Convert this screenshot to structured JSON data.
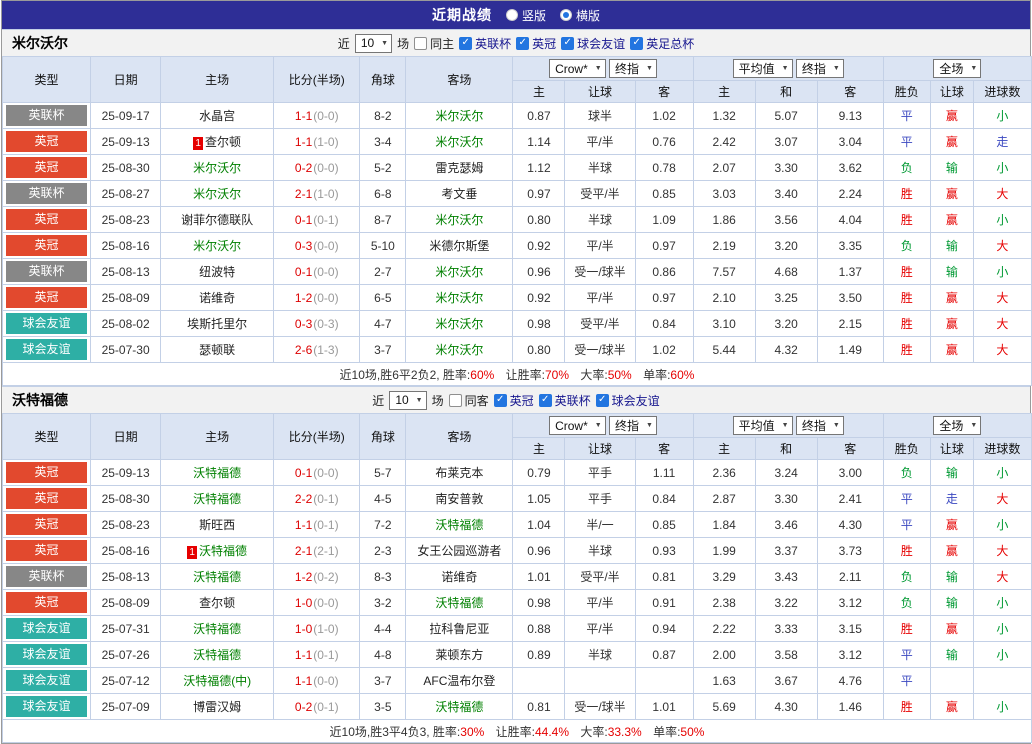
{
  "topbar": {
    "title": "近期战绩",
    "vertical": {
      "label": "竖版",
      "checked": "false"
    },
    "horizontal": {
      "label": "横版",
      "checked": "true"
    }
  },
  "filter_labels": {
    "near": "近",
    "matches": "场"
  },
  "selects": {
    "asia_source": "Crow*",
    "asia_stage": "终指",
    "euro_source": "平均值",
    "euro_stage": "终指",
    "scope": "全场"
  },
  "columns": {
    "type": "类型",
    "date": "日期",
    "home": "主场",
    "score": "比分(半场)",
    "corner": "角球",
    "away": "客场",
    "asia_home": "主",
    "asia_handicap": "让球",
    "asia_away": "客",
    "euro_home": "主",
    "euro_draw": "和",
    "euro_away": "客",
    "res_wdl": "胜负",
    "res_handicap": "让球",
    "res_goals": "进球数"
  },
  "colors": {
    "accent_blue": "#2275e0",
    "topbar": "#2e2e96",
    "league_cup_gray": "#878787",
    "championship_red": "#e2492e",
    "friendly_teal": "#2eafa5",
    "win_red": "#e60000",
    "lose_green": "#009933",
    "draw_blue": "#3b48c0",
    "focus_team_green": "#008000"
  },
  "sections": [
    {
      "team": "米尔沃尔",
      "filter": {
        "count": "10",
        "same_label": "同主",
        "same_checked": "false",
        "leagues": [
          {
            "label": "英联杯",
            "checked": "true"
          },
          {
            "label": "英冠",
            "checked": "true"
          },
          {
            "label": "球会友谊",
            "checked": "true"
          },
          {
            "label": "英足总杯",
            "checked": "true"
          }
        ]
      },
      "rows": [
        {
          "type": "英联杯",
          "tc": "gray",
          "date": "25-09-17",
          "home": "水晶宫",
          "hf": "0",
          "hrc": "",
          "ft": "1-1",
          "ht": "(0-0)",
          "corner": "8-2",
          "away": "米尔沃尔",
          "af": "1",
          "arc": "",
          "a1": "0.87",
          "a2": "球半",
          "a3": "1.02",
          "e1": "1.32",
          "e2": "5.07",
          "e3": "9.13",
          "r1": "平",
          "r1c": "d",
          "r2": "赢",
          "r2c": "w",
          "r3": "小",
          "r3c": "l"
        },
        {
          "type": "英冠",
          "tc": "red",
          "date": "25-09-13",
          "home": "查尔顿",
          "hf": "0",
          "hrc": "1",
          "ft": "1-1",
          "ht": "(1-0)",
          "corner": "3-4",
          "away": "米尔沃尔",
          "af": "1",
          "arc": "",
          "a1": "1.14",
          "a2": "平/半",
          "a3": "0.76",
          "e1": "2.42",
          "e2": "3.07",
          "e3": "3.04",
          "r1": "平",
          "r1c": "d",
          "r2": "赢",
          "r2c": "w",
          "r3": "走",
          "r3c": "d"
        },
        {
          "type": "英冠",
          "tc": "red",
          "date": "25-08-30",
          "home": "米尔沃尔",
          "hf": "1",
          "hrc": "",
          "ft": "0-2",
          "ht": "(0-0)",
          "corner": "5-2",
          "away": "雷克瑟姆",
          "af": "0",
          "arc": "",
          "a1": "1.12",
          "a2": "半球",
          "a3": "0.78",
          "e1": "2.07",
          "e2": "3.30",
          "e3": "3.62",
          "r1": "负",
          "r1c": "l",
          "r2": "输",
          "r2c": "l",
          "r3": "小",
          "r3c": "l"
        },
        {
          "type": "英联杯",
          "tc": "gray",
          "date": "25-08-27",
          "home": "米尔沃尔",
          "hf": "1",
          "hrc": "",
          "ft": "2-1",
          "ht": "(1-0)",
          "corner": "6-8",
          "away": "考文垂",
          "af": "0",
          "arc": "",
          "a1": "0.97",
          "a2": "受平/半",
          "a3": "0.85",
          "e1": "3.03",
          "e2": "3.40",
          "e3": "2.24",
          "r1": "胜",
          "r1c": "w",
          "r2": "赢",
          "r2c": "w",
          "r3": "大",
          "r3c": "w"
        },
        {
          "type": "英冠",
          "tc": "red",
          "date": "25-08-23",
          "home": "谢菲尔德联队",
          "hf": "0",
          "hrc": "",
          "ft": "0-1",
          "ht": "(0-1)",
          "corner": "8-7",
          "away": "米尔沃尔",
          "af": "1",
          "arc": "",
          "a1": "0.80",
          "a2": "半球",
          "a3": "1.09",
          "e1": "1.86",
          "e2": "3.56",
          "e3": "4.04",
          "r1": "胜",
          "r1c": "w",
          "r2": "赢",
          "r2c": "w",
          "r3": "小",
          "r3c": "l"
        },
        {
          "type": "英冠",
          "tc": "red",
          "date": "25-08-16",
          "home": "米尔沃尔",
          "hf": "1",
          "hrc": "",
          "ft": "0-3",
          "ht": "(0-0)",
          "corner": "5-10",
          "away": "米德尔斯堡",
          "af": "0",
          "arc": "",
          "a1": "0.92",
          "a2": "平/半",
          "a3": "0.97",
          "e1": "2.19",
          "e2": "3.20",
          "e3": "3.35",
          "r1": "负",
          "r1c": "l",
          "r2": "输",
          "r2c": "l",
          "r3": "大",
          "r3c": "w"
        },
        {
          "type": "英联杯",
          "tc": "gray",
          "date": "25-08-13",
          "home": "纽波特",
          "hf": "0",
          "hrc": "",
          "ft": "0-1",
          "ht": "(0-0)",
          "corner": "2-7",
          "away": "米尔沃尔",
          "af": "1",
          "arc": "",
          "a1": "0.96",
          "a2": "受一/球半",
          "a3": "0.86",
          "e1": "7.57",
          "e2": "4.68",
          "e3": "1.37",
          "r1": "胜",
          "r1c": "w",
          "r2": "输",
          "r2c": "l",
          "r3": "小",
          "r3c": "l"
        },
        {
          "type": "英冠",
          "tc": "red",
          "date": "25-08-09",
          "home": "诺维奇",
          "hf": "0",
          "hrc": "",
          "ft": "1-2",
          "ht": "(0-0)",
          "corner": "6-5",
          "away": "米尔沃尔",
          "af": "1",
          "arc": "",
          "a1": "0.92",
          "a2": "平/半",
          "a3": "0.97",
          "e1": "2.10",
          "e2": "3.25",
          "e3": "3.50",
          "r1": "胜",
          "r1c": "w",
          "r2": "赢",
          "r2c": "w",
          "r3": "大",
          "r3c": "w"
        },
        {
          "type": "球会友谊",
          "tc": "teal",
          "date": "25-08-02",
          "home": "埃斯托里尔",
          "hf": "0",
          "hrc": "",
          "ft": "0-3",
          "ht": "(0-3)",
          "corner": "4-7",
          "away": "米尔沃尔",
          "af": "1",
          "arc": "",
          "a1": "0.98",
          "a2": "受平/半",
          "a3": "0.84",
          "e1": "3.10",
          "e2": "3.20",
          "e3": "2.15",
          "r1": "胜",
          "r1c": "w",
          "r2": "赢",
          "r2c": "w",
          "r3": "大",
          "r3c": "w"
        },
        {
          "type": "球会友谊",
          "tc": "teal",
          "date": "25-07-30",
          "home": "瑟顿联",
          "hf": "0",
          "hrc": "",
          "ft": "2-6",
          "ht": "(1-3)",
          "corner": "3-7",
          "away": "米尔沃尔",
          "af": "1",
          "arc": "",
          "a1": "0.80",
          "a2": "受一/球半",
          "a3": "1.02",
          "e1": "5.44",
          "e2": "4.32",
          "e3": "1.49",
          "r1": "胜",
          "r1c": "w",
          "r2": "赢",
          "r2c": "w",
          "r3": "大",
          "r3c": "w"
        }
      ],
      "summary": {
        "record": "近10场,胜6平2负2, 胜率:",
        "win": "60%",
        "handicap_label": "让胜率:",
        "handicap": "70%",
        "big_label": "大率:",
        "big": "50%",
        "single_label": "单率:",
        "single": "60%"
      }
    },
    {
      "team": "沃特福德",
      "filter": {
        "count": "10",
        "same_label": "同客",
        "same_checked": "false",
        "leagues": [
          {
            "label": "英冠",
            "checked": "true"
          },
          {
            "label": "英联杯",
            "checked": "true"
          },
          {
            "label": "球会友谊",
            "checked": "true"
          }
        ]
      },
      "rows": [
        {
          "type": "英冠",
          "tc": "red",
          "date": "25-09-13",
          "home": "沃特福德",
          "hf": "1",
          "hrc": "",
          "ft": "0-1",
          "ht": "(0-0)",
          "corner": "5-7",
          "away": "布莱克本",
          "af": "0",
          "arc": "",
          "a1": "0.79",
          "a2": "平手",
          "a3": "1.11",
          "e1": "2.36",
          "e2": "3.24",
          "e3": "3.00",
          "r1": "负",
          "r1c": "l",
          "r2": "输",
          "r2c": "l",
          "r3": "小",
          "r3c": "l"
        },
        {
          "type": "英冠",
          "tc": "red",
          "date": "25-08-30",
          "home": "沃特福德",
          "hf": "1",
          "hrc": "",
          "ft": "2-2",
          "ht": "(0-1)",
          "corner": "4-5",
          "away": "南安普敦",
          "af": "0",
          "arc": "",
          "a1": "1.05",
          "a2": "平手",
          "a3": "0.84",
          "e1": "2.87",
          "e2": "3.30",
          "e3": "2.41",
          "r1": "平",
          "r1c": "d",
          "r2": "走",
          "r2c": "d",
          "r3": "大",
          "r3c": "w"
        },
        {
          "type": "英冠",
          "tc": "red",
          "date": "25-08-23",
          "home": "斯旺西",
          "hf": "0",
          "hrc": "",
          "ft": "1-1",
          "ht": "(0-1)",
          "corner": "7-2",
          "away": "沃特福德",
          "af": "1",
          "arc": "",
          "a1": "1.04",
          "a2": "半/一",
          "a3": "0.85",
          "e1": "1.84",
          "e2": "3.46",
          "e3": "4.30",
          "r1": "平",
          "r1c": "d",
          "r2": "赢",
          "r2c": "w",
          "r3": "小",
          "r3c": "l"
        },
        {
          "type": "英冠",
          "tc": "red",
          "date": "25-08-16",
          "home": "沃特福德",
          "hf": "1",
          "hrc": "1",
          "ft": "2-1",
          "ht": "(2-1)",
          "corner": "2-3",
          "away": "女王公园巡游者",
          "af": "0",
          "arc": "",
          "a1": "0.96",
          "a2": "半球",
          "a3": "0.93",
          "e1": "1.99",
          "e2": "3.37",
          "e3": "3.73",
          "r1": "胜",
          "r1c": "w",
          "r2": "赢",
          "r2c": "w",
          "r3": "大",
          "r3c": "w"
        },
        {
          "type": "英联杯",
          "tc": "gray",
          "date": "25-08-13",
          "home": "沃特福德",
          "hf": "1",
          "hrc": "",
          "ft": "1-2",
          "ht": "(0-2)",
          "corner": "8-3",
          "away": "诺维奇",
          "af": "0",
          "arc": "",
          "a1": "1.01",
          "a2": "受平/半",
          "a3": "0.81",
          "e1": "3.29",
          "e2": "3.43",
          "e3": "2.11",
          "r1": "负",
          "r1c": "l",
          "r2": "输",
          "r2c": "l",
          "r3": "大",
          "r3c": "w"
        },
        {
          "type": "英冠",
          "tc": "red",
          "date": "25-08-09",
          "home": "查尔顿",
          "hf": "0",
          "hrc": "",
          "ft": "1-0",
          "ht": "(0-0)",
          "corner": "3-2",
          "away": "沃特福德",
          "af": "1",
          "arc": "",
          "a1": "0.98",
          "a2": "平/半",
          "a3": "0.91",
          "e1": "2.38",
          "e2": "3.22",
          "e3": "3.12",
          "r1": "负",
          "r1c": "l",
          "r2": "输",
          "r2c": "l",
          "r3": "小",
          "r3c": "l"
        },
        {
          "type": "球会友谊",
          "tc": "teal",
          "date": "25-07-31",
          "home": "沃特福德",
          "hf": "1",
          "hrc": "",
          "ft": "1-0",
          "ht": "(1-0)",
          "corner": "4-4",
          "away": "拉科鲁尼亚",
          "af": "0",
          "arc": "",
          "a1": "0.88",
          "a2": "平/半",
          "a3": "0.94",
          "e1": "2.22",
          "e2": "3.33",
          "e3": "3.15",
          "r1": "胜",
          "r1c": "w",
          "r2": "赢",
          "r2c": "w",
          "r3": "小",
          "r3c": "l"
        },
        {
          "type": "球会友谊",
          "tc": "teal",
          "date": "25-07-26",
          "home": "沃特福德",
          "hf": "1",
          "hrc": "",
          "ft": "1-1",
          "ht": "(0-1)",
          "corner": "4-8",
          "away": "莱顿东方",
          "af": "0",
          "arc": "",
          "a1": "0.89",
          "a2": "半球",
          "a3": "0.87",
          "e1": "2.00",
          "e2": "3.58",
          "e3": "3.12",
          "r1": "平",
          "r1c": "d",
          "r2": "输",
          "r2c": "l",
          "r3": "小",
          "r3c": "l"
        },
        {
          "type": "球会友谊",
          "tc": "teal",
          "date": "25-07-12",
          "home": "沃特福德(中)",
          "hf": "1",
          "hrc": "",
          "ft": "1-1",
          "ht": "(0-0)",
          "corner": "3-7",
          "away": "AFC温布尔登",
          "af": "0",
          "arc": "",
          "a1": "",
          "a2": "",
          "a3": "",
          "e1": "1.63",
          "e2": "3.67",
          "e3": "4.76",
          "r1": "平",
          "r1c": "d",
          "r2": "",
          "r2c": "",
          "r3": "",
          "r3c": ""
        },
        {
          "type": "球会友谊",
          "tc": "teal",
          "date": "25-07-09",
          "home": "博雷汉姆",
          "hf": "0",
          "hrc": "",
          "ft": "0-2",
          "ht": "(0-1)",
          "corner": "3-5",
          "away": "沃特福德",
          "af": "1",
          "arc": "",
          "a1": "0.81",
          "a2": "受一/球半",
          "a3": "1.01",
          "e1": "5.69",
          "e2": "4.30",
          "e3": "1.46",
          "r1": "胜",
          "r1c": "w",
          "r2": "赢",
          "r2c": "w",
          "r3": "小",
          "r3c": "l"
        }
      ],
      "summary": {
        "record": "近10场,胜3平4负3, 胜率:",
        "win": "30%",
        "handicap_label": "让胜率:",
        "handicap": "44.4%",
        "big_label": "大率:",
        "big": "33.3%",
        "single_label": "单率:",
        "single": "50%"
      }
    }
  ]
}
